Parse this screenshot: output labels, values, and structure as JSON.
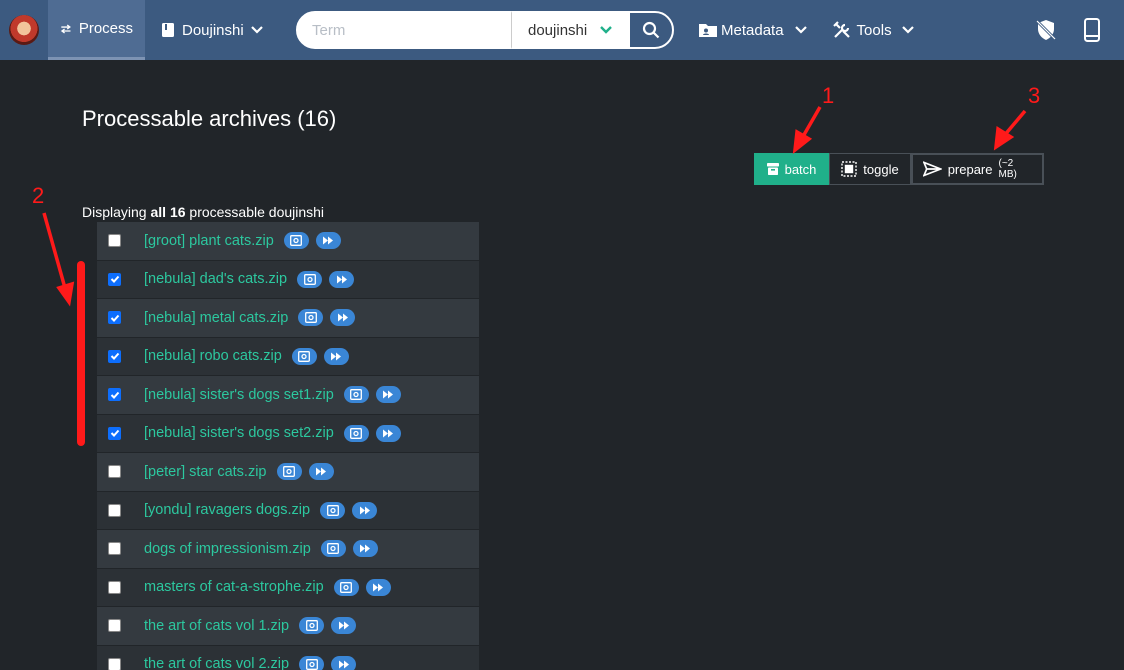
{
  "navbar": {
    "process_label": "Process",
    "category_label": "Doujinshi",
    "search_placeholder": "Term",
    "search_select_value": "doujinshi",
    "metadata_label": "Metadata",
    "tools_label": "Tools"
  },
  "page": {
    "title": "Processable archives (16)",
    "display_prefix": "Displaying",
    "display_bold": "all 16",
    "display_suffix": "processable doujinshi"
  },
  "actions": {
    "batch_label": "batch",
    "toggle_label": "toggle",
    "prepare_label": "prepare",
    "prepare_size": "(~2 MB)"
  },
  "annotations": {
    "one": "1",
    "two": "2",
    "three": "3"
  },
  "colors": {
    "navbar": "#3c5a80",
    "accent": "#20b08a",
    "link": "#2cc89f",
    "annotation": "#ff1a1a"
  },
  "archives": [
    {
      "name": "[groot] plant cats.zip",
      "checked": false
    },
    {
      "name": "[nebula] dad's cats.zip",
      "checked": true
    },
    {
      "name": "[nebula] metal cats.zip",
      "checked": true
    },
    {
      "name": "[nebula] robo cats.zip",
      "checked": true
    },
    {
      "name": "[nebula] sister's dogs set1.zip",
      "checked": true
    },
    {
      "name": "[nebula] sister's dogs set2.zip",
      "checked": true
    },
    {
      "name": "[peter] star cats.zip",
      "checked": false
    },
    {
      "name": "[yondu] ravagers dogs.zip",
      "checked": false
    },
    {
      "name": "dogs of impressionism.zip",
      "checked": false
    },
    {
      "name": "masters of cat-a-strophe.zip",
      "checked": false
    },
    {
      "name": "the art of cats vol 1.zip",
      "checked": false
    },
    {
      "name": "the art of cats vol 2.zip",
      "checked": false
    }
  ]
}
